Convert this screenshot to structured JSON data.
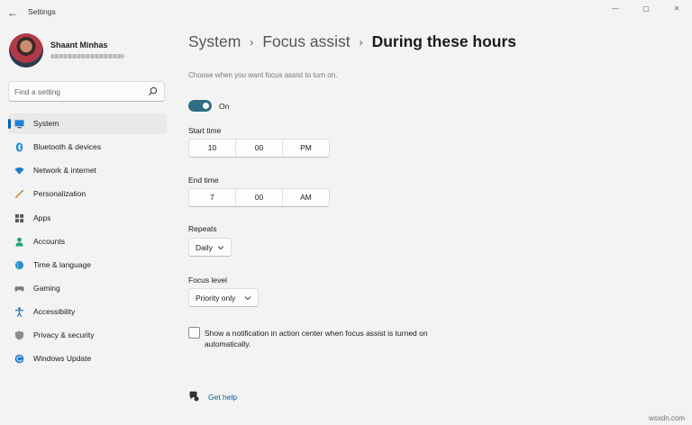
{
  "window": {
    "title": "Settings",
    "back_icon": "←",
    "minimize": "—",
    "maximize": "▢",
    "close": "✕"
  },
  "profile": {
    "name": "Shaant Minhas"
  },
  "search": {
    "placeholder": "Find a setting"
  },
  "accent_color": "#005fb8",
  "toggle_color": "#2f6e83",
  "nav": [
    {
      "label": "System",
      "icon": "monitor-icon",
      "active": true
    },
    {
      "label": "Bluetooth & devices",
      "icon": "bluetooth-icon"
    },
    {
      "label": "Network & internet",
      "icon": "wifi-icon"
    },
    {
      "label": "Personalization",
      "icon": "brush-icon"
    },
    {
      "label": "Apps",
      "icon": "apps-icon"
    },
    {
      "label": "Accounts",
      "icon": "person-icon"
    },
    {
      "label": "Time & language",
      "icon": "globe-icon"
    },
    {
      "label": "Gaming",
      "icon": "gamepad-icon"
    },
    {
      "label": "Accessibility",
      "icon": "accessibility-icon"
    },
    {
      "label": "Privacy & security",
      "icon": "shield-icon"
    },
    {
      "label": "Windows Update",
      "icon": "update-icon"
    }
  ],
  "breadcrumb": {
    "level1": "System",
    "level2": "Focus assist",
    "current": "During these hours",
    "separator": "›"
  },
  "content": {
    "description": "Choose when you want focus assist to turn on.",
    "toggle": {
      "label": "On",
      "state": "on"
    },
    "start_time": {
      "label": "Start time",
      "hour": "10",
      "minute": "00",
      "period": "PM"
    },
    "end_time": {
      "label": "End time",
      "hour": "7",
      "minute": "00",
      "period": "AM"
    },
    "repeats": {
      "label": "Repeats",
      "value": "Daily"
    },
    "focus_level": {
      "label": "Focus level",
      "value": "Priority only"
    },
    "notification_checkbox": {
      "label": "Show a notification in action center when focus assist is turned on automatically.",
      "checked": false
    },
    "get_help": "Get help"
  },
  "watermark": "wsxdn.com"
}
